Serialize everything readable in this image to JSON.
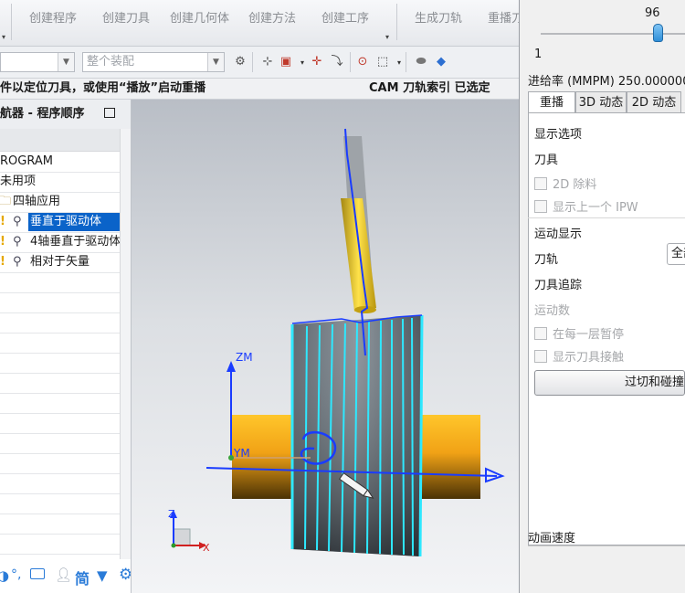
{
  "ribbon": {
    "items": [
      "创建程序",
      "创建刀具",
      "创建几何体",
      "创建方法",
      "创建工序",
      "生成刀轨",
      "重播刀"
    ]
  },
  "toolbar": {
    "filter_value": "",
    "assembly_placeholder": "整个装配"
  },
  "status": {
    "left": "件以定位刀具，或使用“播放”启动重播",
    "right": "CAM 刀轨索引 已选定"
  },
  "navigator": {
    "title": "航器 - 程序顺序",
    "rows": [
      {
        "label": "ROGRAM",
        "icon": "none",
        "selected": false
      },
      {
        "label": "未用项",
        "icon": "none",
        "selected": false
      },
      {
        "label": "四轴应用",
        "icon": "folder-icon",
        "selected": false
      },
      {
        "label": "垂直于驱动体",
        "icon": "operation-icon",
        "selected": true
      },
      {
        "label": "4轴垂直于驱动体",
        "icon": "operation-icon",
        "selected": false
      },
      {
        "label": "相对于矢量",
        "icon": "operation-icon",
        "selected": false
      }
    ],
    "bottom_icons": [
      "mic-icon",
      "dot-icon",
      "keyboard-icon",
      "user-icon",
      "simplified-chinese-icon",
      "shirt-icon",
      "gear-icon"
    ],
    "simplified_label": "简"
  },
  "viewport": {
    "zm_label": "ZM",
    "ym_label": "YM",
    "triad_z": "Z",
    "triad_x": "X"
  },
  "panel": {
    "slider_value": "96",
    "slider_min": "1",
    "slider_fraction": 0.96,
    "feedrate": "进给率 (MMPM) 250.000000",
    "tabs": [
      "重播",
      "3D 动态",
      "2D 动态"
    ],
    "active_tab": "重播",
    "display_options": "显示选项",
    "tool": "刀具",
    "cb_2d_removal": "2D 除料",
    "cb_prev_ipw": "显示上一个 IPW",
    "motion_display": "运动显示",
    "toolpath": "刀轨",
    "toolpath_value": "全部",
    "tool_trace": "刀具追踪",
    "motion_count": "运动数",
    "cb_pause_layer": "在每一层暂停",
    "cb_show_contact": "显示刀具接触",
    "gouge_button": "过切和碰撞",
    "anim_speed": "动画速度"
  },
  "colors": {
    "accent": "#0a63c9",
    "selected_row": "#0a63c9",
    "toolpath_blue": "#1a3cff",
    "cyan_path": "#2ee8ff",
    "tool_yellow": "#e8c020",
    "cylinder_orange": "#e09a10"
  }
}
